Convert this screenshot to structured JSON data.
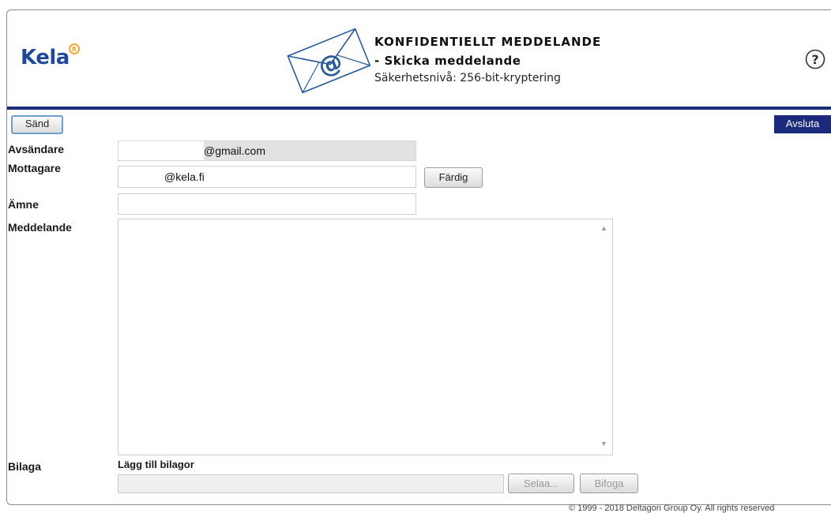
{
  "header": {
    "logo_text": "Kela",
    "title_line1": "KONFIDENTIELLT MEDDELANDE",
    "title_line2": "- Skicka meddelande",
    "title_line3": "Säkerhetsnivå: 256-bit-kryptering",
    "help_icon": "help-icon"
  },
  "toolbar": {
    "send_label": "Sänd",
    "quit_label": "Avsluta"
  },
  "form": {
    "sender_label": "Avsändare",
    "sender_value": "@gmail.com",
    "recipient_label": "Mottagare",
    "recipient_value": "@kela.fi",
    "done_label": "Färdig",
    "subject_label": "Ämne",
    "subject_value": "",
    "message_label": "Meddelande",
    "message_value": "",
    "attachment_label": "Bilaga",
    "add_attachments_label": "Lägg till bilagor",
    "browse_label": "Selaa...",
    "attach_label": "Bifoga"
  },
  "footer": {
    "copyright": "© 1999 - 2018 Deltagon Group Oy. All rights reserved"
  },
  "colors": {
    "brand_blue": "#21489b",
    "bar_navy": "#1b2a7a",
    "logo_accent": "#f0a830"
  }
}
